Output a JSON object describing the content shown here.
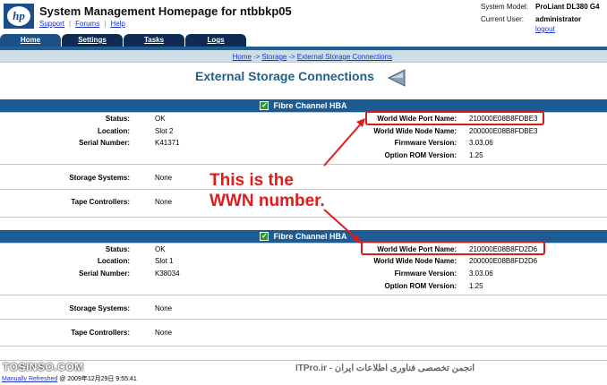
{
  "header": {
    "logo_text": "hp",
    "title": "System Management Homepage for ntbbkp05",
    "links": [
      "Support",
      "Forums",
      "Help"
    ],
    "system_model_label": "System Model:",
    "system_model_value": "ProLiant DL380 G4",
    "current_user_label": "Current User:",
    "current_user_value": "administrator",
    "logout_label": "logout"
  },
  "tabs": [
    {
      "label": "Home",
      "active": true
    },
    {
      "label": "Settings",
      "active": false
    },
    {
      "label": "Tasks",
      "active": false
    },
    {
      "label": "Logs",
      "active": false
    }
  ],
  "breadcrumb": [
    "Home",
    "Storage",
    "External Storage Connections"
  ],
  "breadcrumb_sep": "->",
  "page_title": "External Storage Connections",
  "hbas": [
    {
      "title": "Fibre Channel HBA",
      "status_label": "Status:",
      "status": "OK",
      "location_label": "Location:",
      "location": "Slot 2",
      "serial_label": "Serial Number:",
      "serial": "K41371",
      "wwpn_label": "World Wide Port Name:",
      "wwpn": "210000E08B8FDBE3",
      "wwnn_label": "World Wide Node Name:",
      "wwnn": "200000E08B8FDBE3",
      "firmware_label": "Firmware Version:",
      "firmware": "3.03.06",
      "optrom_label": "Option ROM Version:",
      "optrom": "1.25",
      "storage_label": "Storage Systems:",
      "storage": "None",
      "tape_label": "Tape Controllers:",
      "tape": "None"
    },
    {
      "title": "Fibre Channel HBA",
      "status_label": "Status:",
      "status": "OK",
      "location_label": "Location:",
      "location": "Slot 1",
      "serial_label": "Serial Number:",
      "serial": "K38034",
      "wwpn_label": "World Wide Port Name:",
      "wwpn": "210000E08B8FD2D6",
      "wwnn_label": "World Wide Node Name:",
      "wwnn": "200000E08B8FD2D6",
      "firmware_label": "Firmware Version:",
      "firmware": "3.03.06",
      "optrom_label": "Option ROM Version:",
      "optrom": "1.25",
      "storage_label": "Storage Systems:",
      "storage": "None",
      "tape_label": "Tape Controllers:",
      "tape": "None"
    }
  ],
  "annotation": {
    "line1": "This is the",
    "line2": "WWN number.",
    "color": "#e11b1b"
  },
  "footer": {
    "watermark_left": "TOSINSO.COM",
    "watermark_right": "ITPro.ir - انجمن تخصصی فناوری اطلاعات ایران",
    "refresh_link": "Manually Refreshed",
    "refresh_time": "@ 2009年12月29日 9:55:41"
  },
  "colors": {
    "tab_dark": "#0f2b54",
    "header_blue": "#1d5b94",
    "title_blue": "#1f5f8b",
    "highlight": "#d41c1c"
  }
}
